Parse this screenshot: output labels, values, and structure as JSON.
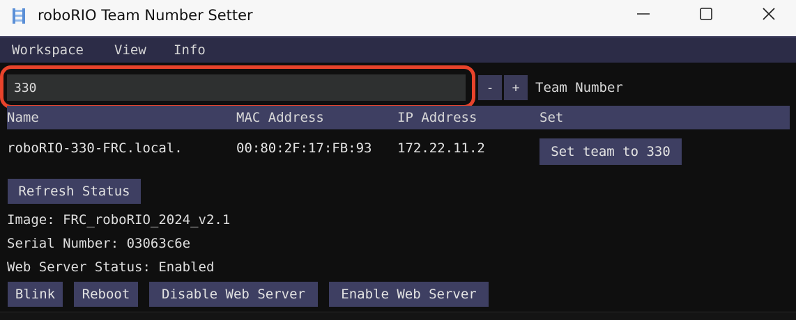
{
  "window": {
    "title": "roboRIO Team Number Setter",
    "icon": "roborio-app-icon",
    "controls": {
      "minimize": "minimize-icon",
      "maximize": "maximize-icon",
      "close": "close-icon"
    }
  },
  "menu": [
    {
      "label": "Workspace"
    },
    {
      "label": "View"
    },
    {
      "label": "Info"
    }
  ],
  "team": {
    "value": "330",
    "decrement_label": "-",
    "increment_label": "+",
    "label": "Team Number"
  },
  "table": {
    "headers": [
      "Name",
      "MAC Address",
      "IP Address",
      "Set"
    ],
    "rows": [
      {
        "name": "roboRIO-330-FRC.local.",
        "mac": "00:80:2F:17:FB:93",
        "ip": "172.22.11.2",
        "action": "Set team to 330"
      }
    ]
  },
  "status": {
    "refresh_label": "Refresh Status",
    "image": "Image: FRC_roboRIO_2024_v2.1",
    "serial": "Serial Number: 03063c6e",
    "web_server": "Web Server Status: Enabled"
  },
  "actions": [
    {
      "label": "Blink"
    },
    {
      "label": "Reboot"
    },
    {
      "label": "Disable Web Server"
    },
    {
      "label": "Enable Web Server"
    }
  ],
  "colors": {
    "background": "#0f0f0f",
    "menubar": "#2c2c47",
    "button": "#3e3f62",
    "input": "#2e3030",
    "highlight": "#e8432b"
  }
}
